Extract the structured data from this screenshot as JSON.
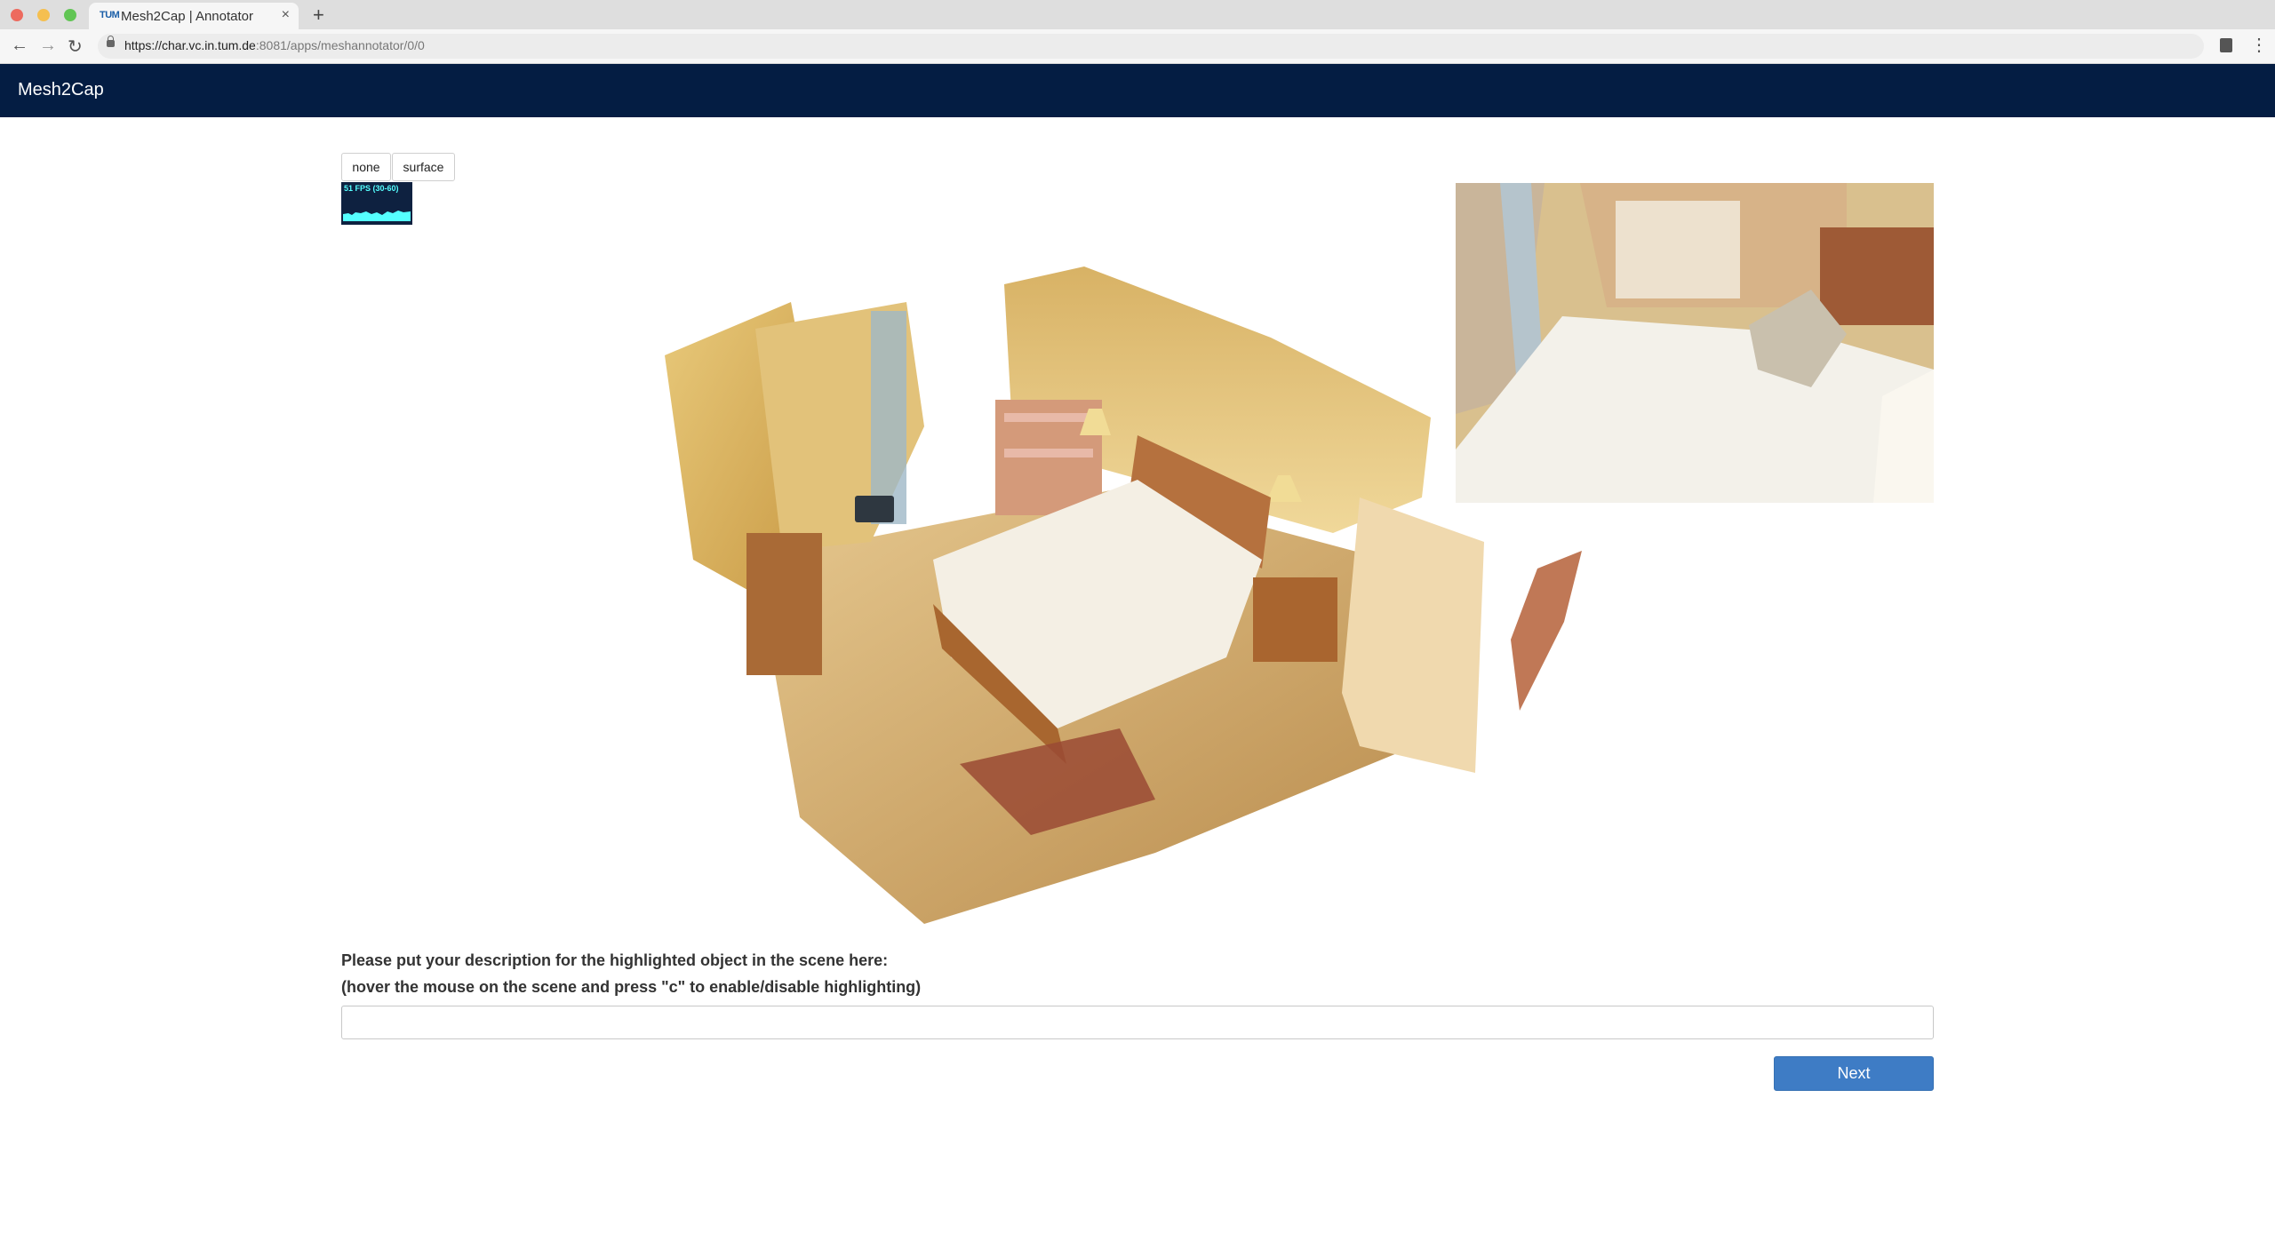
{
  "browser": {
    "tab_title": "Mesh2Cap | Annotator",
    "tab_favicon": "TUM",
    "url_main": "https://char.vc.in.tum.de",
    "url_rest": ":8081/apps/meshannotator/0/0"
  },
  "app": {
    "brand": "Mesh2Cap"
  },
  "visualization": {
    "modes": [
      "none",
      "surface"
    ]
  },
  "stats": {
    "fps_label": "51 FPS (30-60)"
  },
  "form": {
    "prompt_line1": "Please put your description for the highlighted object in the scene here:",
    "prompt_line2": "(hover the mouse on the scene and press \"c\" to enable/disable highlighting)",
    "description_value": "",
    "next_label": "Next"
  },
  "colors": {
    "navbar": "#041d43",
    "primary_button": "#3e7cc5",
    "fps_graph": "#5ff"
  }
}
